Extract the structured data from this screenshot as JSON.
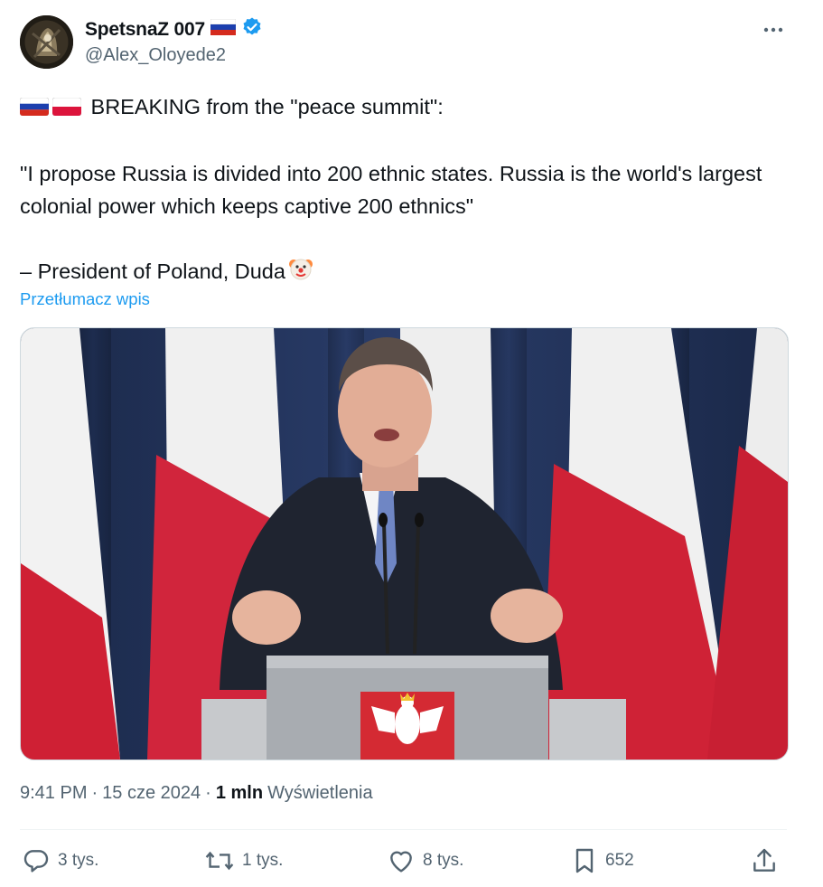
{
  "author": {
    "display_name": "SpetsnaZ 007",
    "handle": "@Alex_Oloyede2",
    "verified": true,
    "name_flag": "russia-flag-icon"
  },
  "tweet": {
    "line1": "BREAKING from the \"peace summit\":",
    "line2": "\"I propose Russia is divided into 200 ethnic states. Russia is the world's largest colonial power which keeps captive 200 ethnics\"",
    "line3": "– President of Poland, Duda",
    "translate_link": "Przetłumacz wpis"
  },
  "meta": {
    "time": "9:41 PM",
    "separator1": "·",
    "date": "15 cze 2024",
    "separator2": "·",
    "views_count": "1 mln",
    "views_label": "Wyświetlenia"
  },
  "actions": {
    "replies": "3 tys.",
    "reposts": "1 tys.",
    "likes": "8 tys.",
    "bookmarks": "652"
  },
  "colors": {
    "accent": "#1d9bf0",
    "secondary_text": "#536471",
    "polish_red": "#d4213d",
    "curtain_blue": "#1f2f55"
  }
}
